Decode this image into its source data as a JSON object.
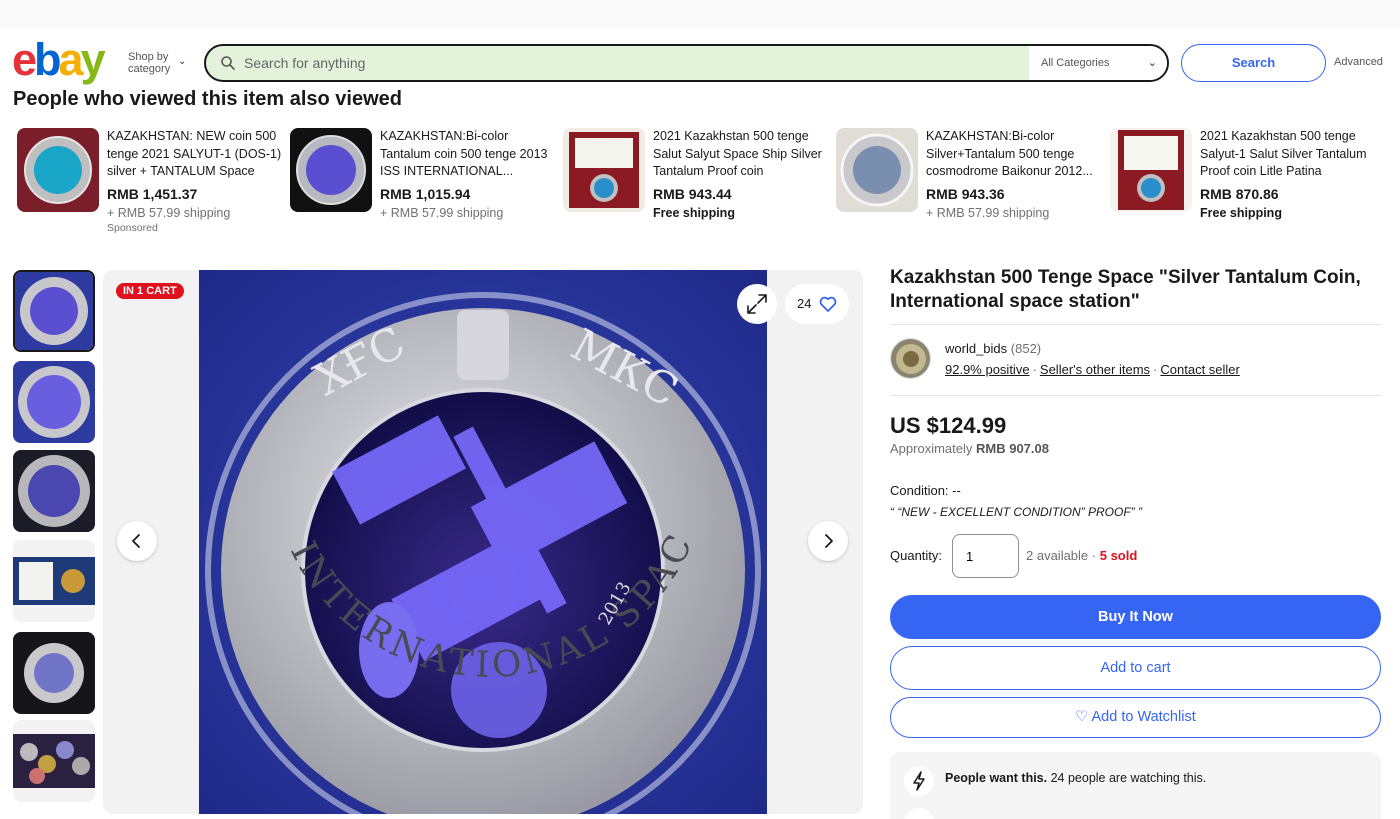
{
  "header": {
    "logo": [
      "e",
      "b",
      "a",
      "y"
    ],
    "shop_by_line1": "Shop by",
    "shop_by_line2": "category",
    "search_placeholder": "Search for anything",
    "category_select": "All Categories",
    "search_button": "Search",
    "advanced_link": "Advanced"
  },
  "also_viewed": {
    "title": "People who viewed this item also viewed",
    "items": [
      {
        "title": "KAZAKHSTAN: NEW coin 500 tenge 2021 SALYUT-1 (DOS-1) silver + TANTALUM Space",
        "price": "RMB 1,451.37",
        "shipping": "+ RMB 57.99 shipping",
        "sponsored": "Sponsored"
      },
      {
        "title": "KAZAKHSTAN:Bi-color Tantalum coin 500 tenge 2013 ISS INTERNATIONAL...",
        "price": "RMB 1,015.94",
        "shipping": "+ RMB 57.99 shipping"
      },
      {
        "title": "2021 Kazakhstan 500 tenge Salut Salyut Space Ship Silver Tantalum Proof coin",
        "price": "RMB 943.44",
        "shipping": "Free shipping"
      },
      {
        "title": "KAZAKHSTAN:Bi-color Silver+Tantalum 500 tenge cosmodrome Baikonur 2012...",
        "price": "RMB 943.36",
        "shipping": "+ RMB 57.99 shipping"
      },
      {
        "title": "2021 Kazakhstan 500 tenge Salyut-1 Salut Silver Tantalum Proof coin Litle Patina",
        "price": "RMB 870.86",
        "shipping": "Free shipping"
      }
    ]
  },
  "gallery": {
    "badge": "IN 1 CART",
    "watch_count": "24",
    "coin_top_left": "ХҒС",
    "coin_top_right": "МКС",
    "coin_ring_text": "INTERNATIONAL SPACE STATION",
    "coin_year": "2013"
  },
  "product": {
    "title": "Kazakhstan 500 Tenge Space \"Silver Tantalum Coin, International space station\"",
    "seller_name": "world_bids",
    "seller_feedback": "(852)",
    "positive": "92.9% positive",
    "other_items": "Seller's other items",
    "contact": "Contact seller",
    "price": "US $124.99",
    "approx_label": "Approximately",
    "approx_value": "RMB 907.08",
    "condition_label": "Condition:",
    "condition_value": "--",
    "condition_desc": "“ “NEW - EXCELLENT CONDITION” PROOF” ”",
    "quantity_label": "Quantity:",
    "quantity_value": "1",
    "available": "2 available ·",
    "sold": "5 sold",
    "buy_now": "Buy It Now",
    "add_to_cart": "Add to cart",
    "add_to_watchlist": "♡ Add to Watchlist",
    "promo_bold": "People want this.",
    "promo_text": " 24 people are watching this."
  },
  "colors": {
    "ebay_red": "#e53238",
    "ebay_blue": "#0064d2",
    "ebay_yellow": "#f5af02",
    "ebay_green": "#86b817",
    "action_blue": "#3665f3",
    "badge_red": "#e0101d",
    "search_bg": "#e3f2da"
  }
}
